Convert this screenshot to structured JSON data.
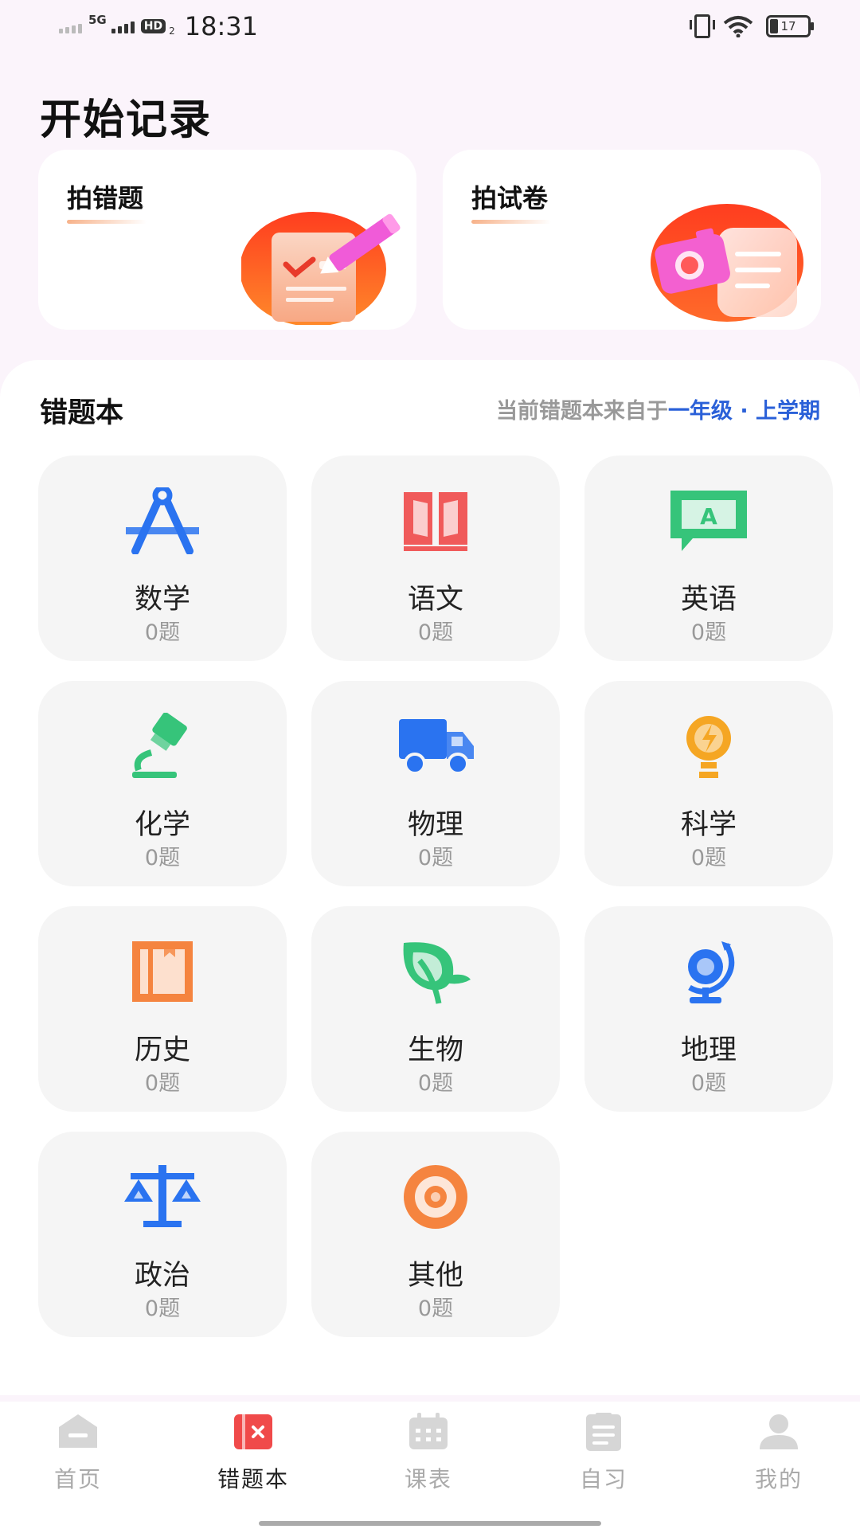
{
  "status_bar": {
    "network": "5G",
    "hd": "HD",
    "hd_sub": "2",
    "time": "18:31",
    "battery": "17"
  },
  "header": {
    "title": "开始记录"
  },
  "record_cards": [
    {
      "label": "拍错题",
      "icon": "clipboard-check-pencil-icon"
    },
    {
      "label": "拍试卷",
      "icon": "camera-paper-icon"
    }
  ],
  "mistake_book": {
    "title": "错题本",
    "source_prefix": "当前错题本来自于",
    "source_grade": "一年级 · 上学期",
    "subjects": [
      {
        "name": "数学",
        "count": "0题",
        "icon": "compass-icon",
        "color": "#2a73f0"
      },
      {
        "name": "语文",
        "count": "0题",
        "icon": "book-icon",
        "color": "#f05a5a"
      },
      {
        "name": "英语",
        "count": "0题",
        "icon": "speech-board-icon",
        "color": "#36c47a"
      },
      {
        "name": "化学",
        "count": "0题",
        "icon": "microscope-icon",
        "color": "#36c47a"
      },
      {
        "name": "物理",
        "count": "0题",
        "icon": "truck-icon",
        "color": "#2a73f0"
      },
      {
        "name": "科学",
        "count": "0题",
        "icon": "bulb-icon",
        "color": "#f5a623"
      },
      {
        "name": "历史",
        "count": "0题",
        "icon": "bookmark-book-icon",
        "color": "#f5843f"
      },
      {
        "name": "生物",
        "count": "0题",
        "icon": "leaf-icon",
        "color": "#36c47a"
      },
      {
        "name": "地理",
        "count": "0题",
        "icon": "globe-icon",
        "color": "#2a73f0"
      },
      {
        "name": "政治",
        "count": "0题",
        "icon": "scales-icon",
        "color": "#2a73f0"
      },
      {
        "name": "其他",
        "count": "0题",
        "icon": "target-icon",
        "color": "#f5843f"
      }
    ]
  },
  "bottom_nav": [
    {
      "label": "首页",
      "icon": "home-icon",
      "active": false
    },
    {
      "label": "错题本",
      "icon": "mistake-book-icon",
      "active": true
    },
    {
      "label": "课表",
      "icon": "calendar-icon",
      "active": false
    },
    {
      "label": "自习",
      "icon": "clipboard-icon",
      "active": false
    },
    {
      "label": "我的",
      "icon": "user-icon",
      "active": false
    }
  ]
}
